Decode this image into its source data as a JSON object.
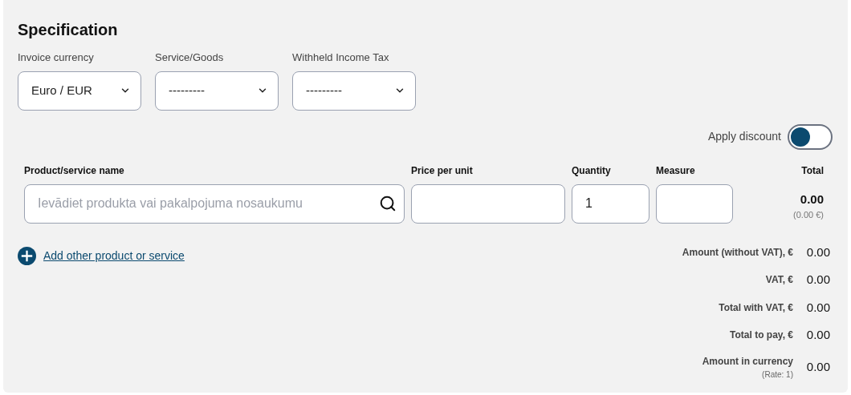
{
  "title": "Specification",
  "selects": [
    {
      "label": "Invoice currency",
      "value": "Euro / EUR"
    },
    {
      "label": "Service/Goods",
      "value": "---------"
    },
    {
      "label": "Withheld Income Tax",
      "value": "---------"
    }
  ],
  "discount": {
    "label": "Apply discount",
    "on": false
  },
  "line_item": {
    "columns": [
      "Product/service name",
      "Price per unit",
      "Quantity",
      "Measure",
      "Total"
    ],
    "name_placeholder": "Ievādiet produkta vai pakalpojuma nosaukumu",
    "quantity": "1",
    "total": "0.00",
    "total_eur": "(0.00 €)"
  },
  "add_link": "Add other product or service",
  "summary": [
    {
      "label": "Amount (without VAT), €",
      "value": "0.00"
    },
    {
      "label": "VAT, €",
      "value": "0.00"
    },
    {
      "label": "Total with VAT, €",
      "value": "0.00"
    },
    {
      "label": "Total to pay, €",
      "value": "0.00"
    },
    {
      "label": "Amount in currency",
      "note": "(Rate: 1)",
      "value": "0.00"
    }
  ]
}
